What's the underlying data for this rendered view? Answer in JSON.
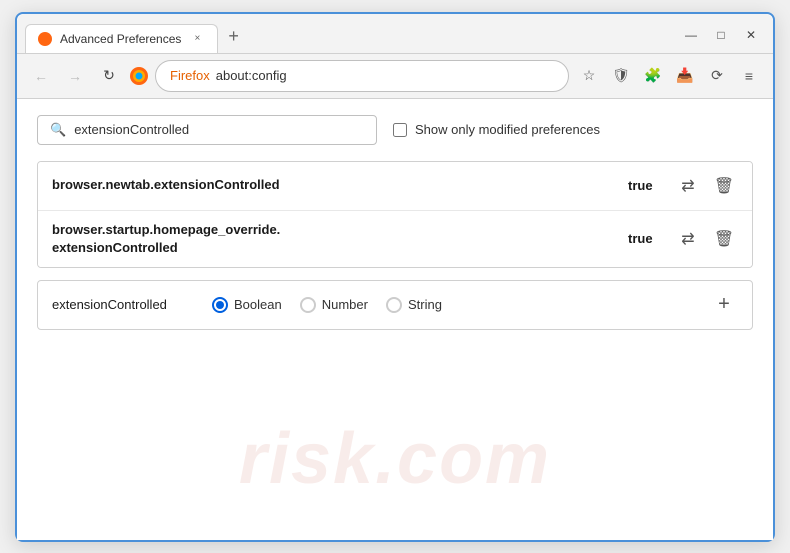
{
  "window": {
    "title": "Advanced Preferences",
    "tab_close": "×",
    "tab_new": "+",
    "win_minimize": "—",
    "win_maximize": "□",
    "win_close": "✕"
  },
  "nav": {
    "back": "←",
    "forward": "→",
    "reload": "↻",
    "firefox_label": "Firefox",
    "address": "about:config",
    "bookmark_icon": "☆",
    "shield_icon": "🛡",
    "extension_icon": "🧩",
    "download_icon": "📥",
    "sync_icon": "⟳",
    "menu_icon": "≡"
  },
  "search": {
    "placeholder": "extensionControlled",
    "value": "extensionControlled",
    "show_modified_label": "Show only modified preferences"
  },
  "preferences": [
    {
      "name": "browser.newtab.extensionControlled",
      "value": "true"
    },
    {
      "name": "browser.startup.homepage_override.\nextensionControlled",
      "name_line1": "browser.startup.homepage_override.",
      "name_line2": "extensionControlled",
      "value": "true",
      "multiline": true
    }
  ],
  "new_pref": {
    "name": "extensionControlled",
    "types": [
      "Boolean",
      "Number",
      "String"
    ],
    "selected_type": "Boolean",
    "add_btn": "+"
  },
  "watermark": {
    "text": "risk.com"
  },
  "icons": {
    "search": "🔍",
    "arrows": "⇄",
    "trash": "🗑",
    "plus": "+"
  }
}
